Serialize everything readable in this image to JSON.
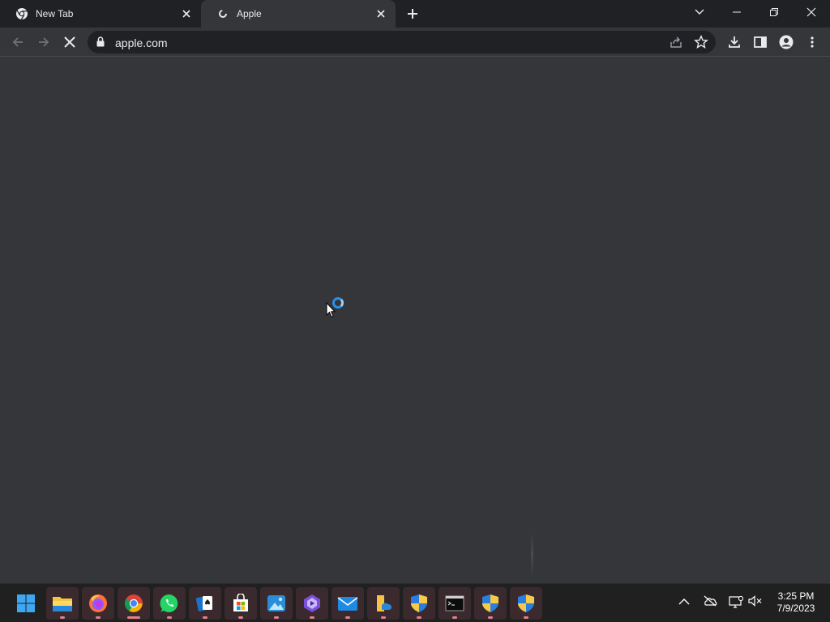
{
  "tabs": [
    {
      "title": "New Tab",
      "icon": "chrome-icon"
    },
    {
      "title": "Apple",
      "icon": "loading-icon"
    }
  ],
  "omnibox": {
    "url": "apple.com"
  },
  "taskbar": {
    "apps": [
      "start",
      "file-explorer",
      "firefox",
      "chrome",
      "whatsapp",
      "solitaire",
      "microsoft-store",
      "photos",
      "clipchamp",
      "mail",
      "files",
      "security-shield",
      "terminal",
      "security-shield",
      "security-shield"
    ]
  },
  "clock": {
    "time": "3:25 PM",
    "date": "7/9/2023"
  },
  "colors": {
    "tabstrip": "#202124",
    "toolbar": "#35363a",
    "accent": "#2f8de4",
    "taskbar": "#202020"
  }
}
